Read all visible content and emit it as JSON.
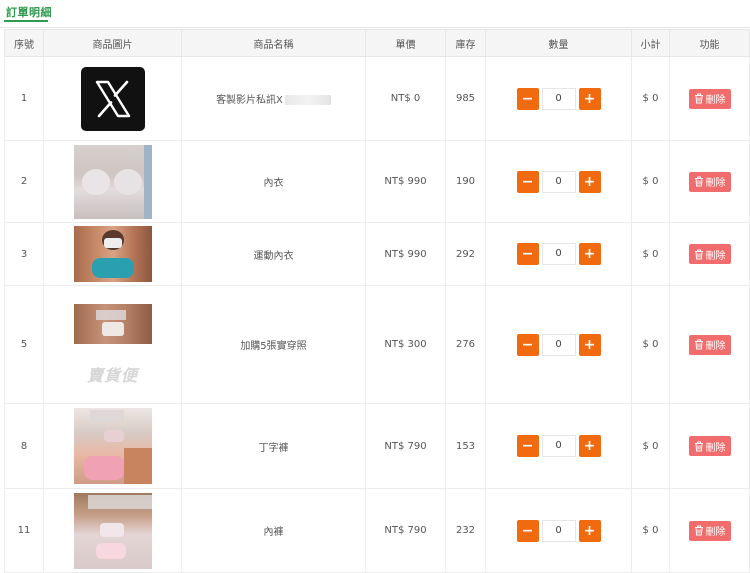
{
  "tab": {
    "label": "訂單明細"
  },
  "headers": [
    "序號",
    "商品圖片",
    "商品名稱",
    "單價",
    "庫存",
    "數量",
    "小計",
    "功能"
  ],
  "rows": [
    {
      "seq": "1",
      "name": "客製影片私訊X",
      "price": "NT$ 0",
      "stock": "985",
      "qty": "0",
      "subtotal": "$ 0",
      "action": "刪除",
      "image": "x-logo"
    },
    {
      "seq": "2",
      "name": "內衣",
      "price": "NT$ 990",
      "stock": "190",
      "qty": "0",
      "subtotal": "$ 0",
      "action": "刪除",
      "image": "photo"
    },
    {
      "seq": "3",
      "name": "運動內衣",
      "price": "NT$ 990",
      "stock": "292",
      "qty": "0",
      "subtotal": "$ 0",
      "action": "刪除",
      "image": "photo"
    },
    {
      "seq": "5",
      "name": "加購5張實穿照",
      "price": "NT$ 300",
      "stock": "276",
      "qty": "0",
      "subtotal": "$ 0",
      "action": "刪除",
      "image": "photo-with-logo"
    },
    {
      "seq": "8",
      "name": "丁字褲",
      "price": "NT$ 790",
      "stock": "153",
      "qty": "0",
      "subtotal": "$ 0",
      "action": "刪除",
      "image": "photo"
    },
    {
      "seq": "11",
      "name": "內褲",
      "price": "NT$ 790",
      "stock": "232",
      "qty": "0",
      "subtotal": "$ 0",
      "action": "刪除",
      "image": "photo"
    }
  ],
  "qty_controls": {
    "minus": "−",
    "plus": "+"
  },
  "colors": {
    "accent": "#2e9b4f",
    "qty_button": "#f26a10",
    "delete_button": "#f16c6c"
  }
}
